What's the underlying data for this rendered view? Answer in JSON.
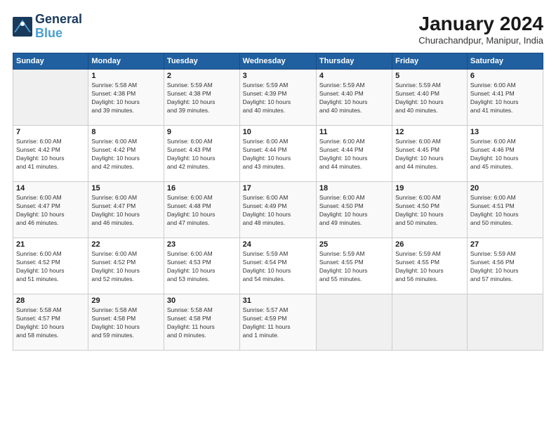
{
  "header": {
    "logo_line1": "General",
    "logo_line2": "Blue",
    "month": "January 2024",
    "location": "Churachandpur, Manipur, India"
  },
  "weekdays": [
    "Sunday",
    "Monday",
    "Tuesday",
    "Wednesday",
    "Thursday",
    "Friday",
    "Saturday"
  ],
  "weeks": [
    [
      {
        "day": "",
        "info": ""
      },
      {
        "day": "1",
        "info": "Sunrise: 5:58 AM\nSunset: 4:38 PM\nDaylight: 10 hours\nand 39 minutes."
      },
      {
        "day": "2",
        "info": "Sunrise: 5:59 AM\nSunset: 4:38 PM\nDaylight: 10 hours\nand 39 minutes."
      },
      {
        "day": "3",
        "info": "Sunrise: 5:59 AM\nSunset: 4:39 PM\nDaylight: 10 hours\nand 40 minutes."
      },
      {
        "day": "4",
        "info": "Sunrise: 5:59 AM\nSunset: 4:40 PM\nDaylight: 10 hours\nand 40 minutes."
      },
      {
        "day": "5",
        "info": "Sunrise: 5:59 AM\nSunset: 4:40 PM\nDaylight: 10 hours\nand 40 minutes."
      },
      {
        "day": "6",
        "info": "Sunrise: 6:00 AM\nSunset: 4:41 PM\nDaylight: 10 hours\nand 41 minutes."
      }
    ],
    [
      {
        "day": "7",
        "info": "Sunrise: 6:00 AM\nSunset: 4:42 PM\nDaylight: 10 hours\nand 41 minutes."
      },
      {
        "day": "8",
        "info": "Sunrise: 6:00 AM\nSunset: 4:42 PM\nDaylight: 10 hours\nand 42 minutes."
      },
      {
        "day": "9",
        "info": "Sunrise: 6:00 AM\nSunset: 4:43 PM\nDaylight: 10 hours\nand 42 minutes."
      },
      {
        "day": "10",
        "info": "Sunrise: 6:00 AM\nSunset: 4:44 PM\nDaylight: 10 hours\nand 43 minutes."
      },
      {
        "day": "11",
        "info": "Sunrise: 6:00 AM\nSunset: 4:44 PM\nDaylight: 10 hours\nand 44 minutes."
      },
      {
        "day": "12",
        "info": "Sunrise: 6:00 AM\nSunset: 4:45 PM\nDaylight: 10 hours\nand 44 minutes."
      },
      {
        "day": "13",
        "info": "Sunrise: 6:00 AM\nSunset: 4:46 PM\nDaylight: 10 hours\nand 45 minutes."
      }
    ],
    [
      {
        "day": "14",
        "info": "Sunrise: 6:00 AM\nSunset: 4:47 PM\nDaylight: 10 hours\nand 46 minutes."
      },
      {
        "day": "15",
        "info": "Sunrise: 6:00 AM\nSunset: 4:47 PM\nDaylight: 10 hours\nand 46 minutes."
      },
      {
        "day": "16",
        "info": "Sunrise: 6:00 AM\nSunset: 4:48 PM\nDaylight: 10 hours\nand 47 minutes."
      },
      {
        "day": "17",
        "info": "Sunrise: 6:00 AM\nSunset: 4:49 PM\nDaylight: 10 hours\nand 48 minutes."
      },
      {
        "day": "18",
        "info": "Sunrise: 6:00 AM\nSunset: 4:50 PM\nDaylight: 10 hours\nand 49 minutes."
      },
      {
        "day": "19",
        "info": "Sunrise: 6:00 AM\nSunset: 4:50 PM\nDaylight: 10 hours\nand 50 minutes."
      },
      {
        "day": "20",
        "info": "Sunrise: 6:00 AM\nSunset: 4:51 PM\nDaylight: 10 hours\nand 50 minutes."
      }
    ],
    [
      {
        "day": "21",
        "info": "Sunrise: 6:00 AM\nSunset: 4:52 PM\nDaylight: 10 hours\nand 51 minutes."
      },
      {
        "day": "22",
        "info": "Sunrise: 6:00 AM\nSunset: 4:52 PM\nDaylight: 10 hours\nand 52 minutes."
      },
      {
        "day": "23",
        "info": "Sunrise: 6:00 AM\nSunset: 4:53 PM\nDaylight: 10 hours\nand 53 minutes."
      },
      {
        "day": "24",
        "info": "Sunrise: 5:59 AM\nSunset: 4:54 PM\nDaylight: 10 hours\nand 54 minutes."
      },
      {
        "day": "25",
        "info": "Sunrise: 5:59 AM\nSunset: 4:55 PM\nDaylight: 10 hours\nand 55 minutes."
      },
      {
        "day": "26",
        "info": "Sunrise: 5:59 AM\nSunset: 4:55 PM\nDaylight: 10 hours\nand 56 minutes."
      },
      {
        "day": "27",
        "info": "Sunrise: 5:59 AM\nSunset: 4:56 PM\nDaylight: 10 hours\nand 57 minutes."
      }
    ],
    [
      {
        "day": "28",
        "info": "Sunrise: 5:58 AM\nSunset: 4:57 PM\nDaylight: 10 hours\nand 58 minutes."
      },
      {
        "day": "29",
        "info": "Sunrise: 5:58 AM\nSunset: 4:58 PM\nDaylight: 10 hours\nand 59 minutes."
      },
      {
        "day": "30",
        "info": "Sunrise: 5:58 AM\nSunset: 4:58 PM\nDaylight: 11 hours\nand 0 minutes."
      },
      {
        "day": "31",
        "info": "Sunrise: 5:57 AM\nSunset: 4:59 PM\nDaylight: 11 hours\nand 1 minute."
      },
      {
        "day": "",
        "info": ""
      },
      {
        "day": "",
        "info": ""
      },
      {
        "day": "",
        "info": ""
      }
    ]
  ]
}
